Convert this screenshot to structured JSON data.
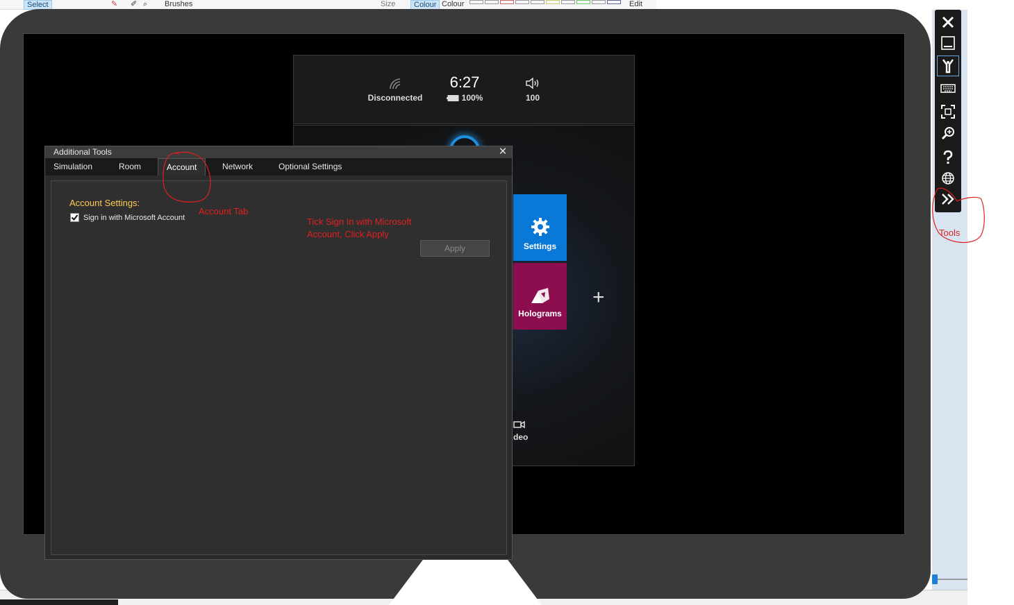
{
  "paint_ribbon": {
    "select_label": "Select",
    "brushes_label": "Brushes",
    "size_label": "Size",
    "colour1_label": "Colour",
    "colour2_label": "Colour",
    "edit_label": "Edit"
  },
  "toolbar": {
    "items": [
      {
        "icon": "close-icon"
      },
      {
        "icon": "minimize-icon"
      },
      {
        "icon": "hand-gesture-icon"
      },
      {
        "icon": "keyboard-icon"
      },
      {
        "icon": "fit-to-screen-icon"
      },
      {
        "icon": "zoom-icon"
      },
      {
        "icon": "help-icon"
      },
      {
        "icon": "globe-icon"
      },
      {
        "icon": "tools-chevron-icon"
      }
    ]
  },
  "hud": {
    "wifi_label": "Disconnected",
    "time": "6:27",
    "battery_label": "100%",
    "volume_label": "100"
  },
  "start_menu": {
    "settings_tile": "Settings",
    "holograms_tile": "Holograms",
    "plus_symbol": "+",
    "video_label": "deo"
  },
  "dialog": {
    "title": "Additional Tools",
    "close_symbol": "✕",
    "tabs": [
      "Simulation",
      "Room",
      "Account",
      "Network",
      "Optional Settings"
    ],
    "active_tab": "Account",
    "section_heading": "Account Settings:",
    "checkbox_label": "Sign in with Microsoft Account",
    "checkbox_checked": true,
    "apply_label": "Apply"
  },
  "annotations": {
    "account_tab": "Account Tab",
    "instruction_line1": "Tick Sign In with Microsoft",
    "instruction_line2": "Account, Click Apply",
    "tools": "Tools"
  },
  "colors": {
    "annotation_red": "#e02020",
    "settings_tile": "#0a78d7",
    "holograms_tile": "#8c0e4f",
    "heading_yellow": "#ffcc55"
  }
}
